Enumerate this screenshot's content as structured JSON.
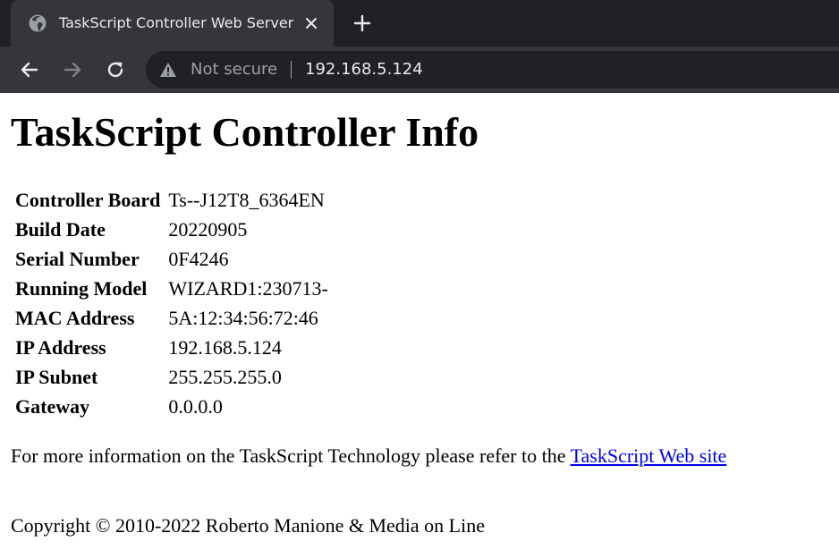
{
  "browser": {
    "tab_title": "TaskScript Controller Web Server",
    "tab_favicon_icon": "globe-icon",
    "tab_close_icon": "close-icon",
    "new_tab_icon": "plus-icon",
    "nav_icons": [
      "back-arrow-icon",
      "forward-arrow-icon",
      "reload-icon"
    ],
    "security_icon": "warning-triangle-icon",
    "security_label": "Not secure",
    "url": "192.168.5.124",
    "colors": {
      "tabstrip": "#202124",
      "active_tab": "#35363a",
      "toolbar": "#35363a",
      "omnibox": "#202124",
      "text": "#e8eaed",
      "muted": "#9aa0a6"
    }
  },
  "page": {
    "title": "TaskScript Controller Info",
    "info_rows": [
      {
        "label": "Controller Board",
        "value": "Ts--J12T8_6364EN"
      },
      {
        "label": "Build Date",
        "value": "20220905"
      },
      {
        "label": "Serial Number",
        "value": "0F4246"
      },
      {
        "label": "Running Model",
        "value": "WIZARD1:230713-"
      },
      {
        "label": "MAC Address",
        "value": "5A:12:34:56:72:46"
      },
      {
        "label": "IP Address",
        "value": "192.168.5.124"
      },
      {
        "label": "IP Subnet",
        "value": "255.255.255.0"
      },
      {
        "label": "Gateway",
        "value": "0.0.0.0"
      }
    ],
    "more_info_text": "For more information on the TaskScript Technology please refer to the ",
    "more_info_link": "TaskScript Web site",
    "copyright": "Copyright © 2010-2022 Roberto Manione & Media on Line",
    "link_color": "#0000ee"
  }
}
